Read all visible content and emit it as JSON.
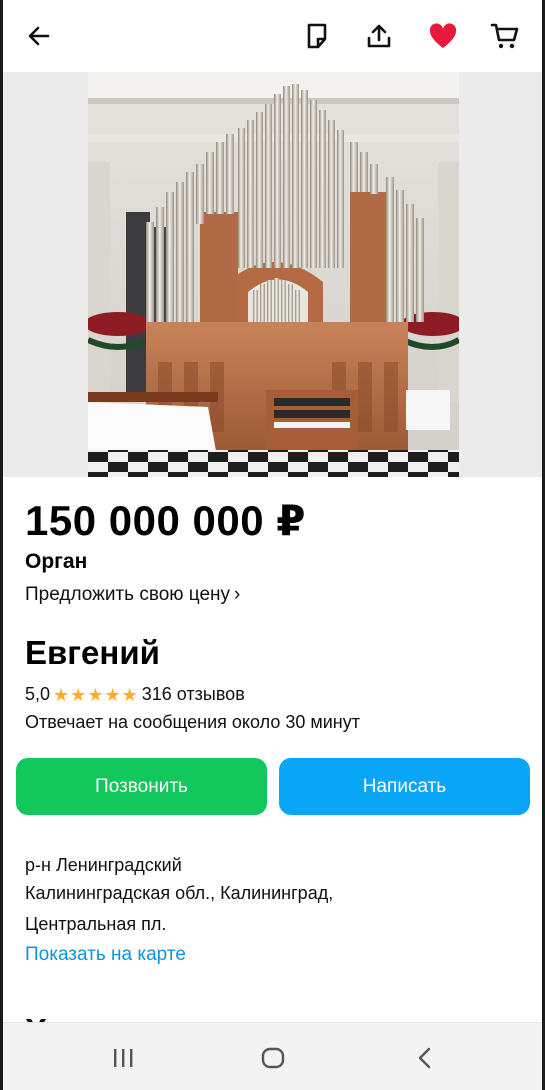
{
  "toolbar": {
    "back_icon": "arrow-left-icon",
    "note_icon": "note-icon",
    "share_icon": "share-icon",
    "favorite_icon": "heart-icon",
    "cart_icon": "cart-icon",
    "favorite_color": "#e8193c"
  },
  "listing": {
    "price": "150 000 000 ₽",
    "title": "Орган",
    "offer_price_label": "Предложить свою цену",
    "offer_chevron": "›"
  },
  "seller": {
    "name": "Евгений",
    "rating": "5,0",
    "stars": 5,
    "reviews": "316 отзывов",
    "response_time": "Отвечает на сообщения около 30 минут"
  },
  "actions": {
    "call_label": "Позвонить",
    "write_label": "Написать",
    "call_color": "#12c75c",
    "write_color": "#09a6f8"
  },
  "location": {
    "district": "р-н Ленинградский",
    "region": "Калининградская обл., Калининград,",
    "street": "Центральная пл.",
    "map_link": "Показать на карте"
  },
  "next_section": {
    "heading": "Характеристики"
  },
  "system_nav": {
    "recent_icon": "recent-apps-icon",
    "home_icon": "home-icon",
    "back_icon": "back-chevron-icon"
  }
}
